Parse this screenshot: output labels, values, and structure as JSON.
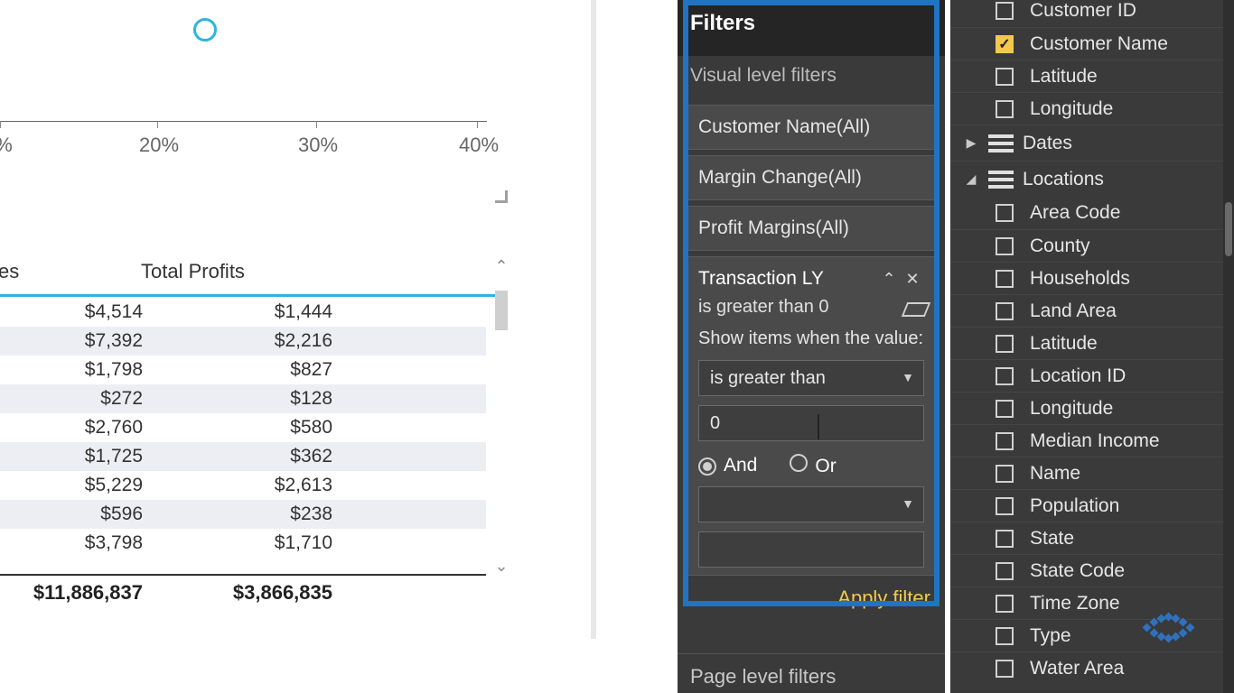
{
  "chart": {
    "axis_labels": [
      "20%",
      "30%",
      "40%"
    ],
    "axis_partial_label": "%"
  },
  "table": {
    "headers": {
      "col_a_suffix": "es",
      "col_b": "Total Profits"
    },
    "rows": [
      {
        "a": "$4,514",
        "b": "$1,444"
      },
      {
        "a": "$7,392",
        "b": "$2,216"
      },
      {
        "a": "$1,798",
        "b": "$827"
      },
      {
        "a": "$272",
        "b": "$128"
      },
      {
        "a": "$2,760",
        "b": "$580"
      },
      {
        "a": "$1,725",
        "b": "$362"
      },
      {
        "a": "$5,229",
        "b": "$2,613"
      },
      {
        "a": "$596",
        "b": "$238"
      },
      {
        "a": "$3,798",
        "b": "$1,710"
      }
    ],
    "footer": {
      "a": "$11,886,837",
      "b": "$3,866,835"
    }
  },
  "filters": {
    "title": "Filters",
    "visual_level_label": "Visual level filters",
    "page_level_label": "Page level filters",
    "cards": [
      {
        "label": "Customer Name(All)"
      },
      {
        "label": "Margin Change(All)"
      },
      {
        "label": "Profit Margins(All)"
      }
    ],
    "active": {
      "name": "Transaction LY",
      "summary": "is greater than 0",
      "help": "Show items when the value:",
      "op1": "is greater than",
      "val1": "0",
      "and": "And",
      "or": "Or",
      "apply": "Apply filter"
    }
  },
  "fields": {
    "top_items": [
      {
        "label": "Customer ID",
        "checked": false
      },
      {
        "label": "Customer Name",
        "checked": true
      },
      {
        "label": "Latitude",
        "checked": false
      },
      {
        "label": "Longitude",
        "checked": false
      }
    ],
    "groups": [
      {
        "label": "Dates",
        "expanded": false
      },
      {
        "label": "Locations",
        "expanded": true
      }
    ],
    "location_items": [
      "Area Code",
      "County",
      "Households",
      "Land Area",
      "Latitude",
      "Location ID",
      "Longitude",
      "Median Income",
      "Name",
      "Population",
      "State",
      "State Code",
      "Time Zone",
      "Type",
      "Water Area"
    ]
  }
}
